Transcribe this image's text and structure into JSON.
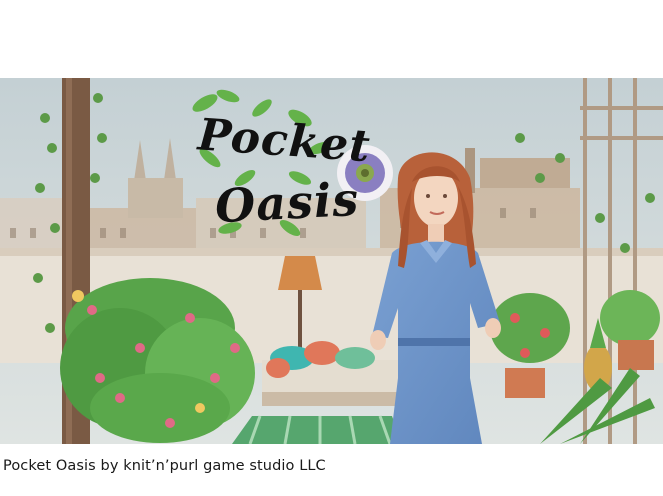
{
  "artwork": {
    "logo_line1": "Pocket",
    "logo_line2": "Oasis",
    "colors": {
      "sky": "#c9d3d6",
      "wall": "#e8e1d6",
      "post": "#7a5a44",
      "jumpsuit": "#6f95c8",
      "hair": "#b8613a",
      "leaf": "#58a44a",
      "flower_pink": "#e06a86"
    }
  },
  "caption": {
    "text": "Pocket Oasis by knit’n’purl game studio LLC"
  }
}
